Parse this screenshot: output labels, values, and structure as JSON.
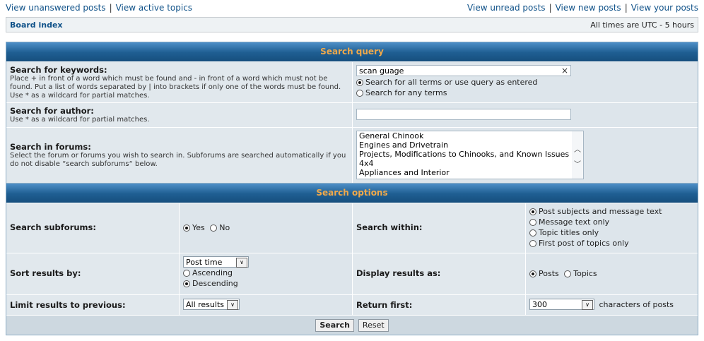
{
  "toplinks": {
    "unanswered": "View unanswered posts",
    "active": "View active topics",
    "unread": "View unread posts",
    "new": "View new posts",
    "yours": "View your posts",
    "separator": "|"
  },
  "navbar": {
    "board_index": "Board index",
    "timezone": "All times are UTC - 5 hours"
  },
  "search_query": {
    "heading": "Search query",
    "keywords_label": "Search for keywords:",
    "keywords_explain": "Place + in front of a word which must be found and - in front of a word which must not be found. Put a list of words separated by | into brackets if only one of the words must be found. Use * as a wildcard for partial matches.",
    "keywords_value": "scan guage",
    "terms_all": "Search for all terms or use query as entered",
    "terms_any": "Search for any terms",
    "author_label": "Search for author:",
    "author_explain": "Use * as a wildcard for partial matches.",
    "author_value": "",
    "forums_label": "Search in forums:",
    "forums_explain": "Select the forum or forums you wish to search in. Subforums are searched automatically if you do not disable “search subforums“ below.",
    "forums": [
      "General Chinook",
      "Engines and Drivetrain",
      "Projects, Modifications to Chinooks, and Known Issues",
      "4x4",
      "Appliances and Interior"
    ]
  },
  "search_options": {
    "heading": "Search options",
    "subforums_label": "Search subforums:",
    "yes": "Yes",
    "no": "No",
    "within_label": "Search within:",
    "within_opts": [
      "Post subjects and message text",
      "Message text only",
      "Topic titles only",
      "First post of topics only"
    ],
    "sort_label": "Sort results by:",
    "sort_value": "Post time",
    "ascending": "Ascending",
    "descending": "Descending",
    "display_label": "Display results as:",
    "posts": "Posts",
    "topics": "Topics",
    "limit_label": "Limit results to previous:",
    "limit_value": "All results",
    "return_label": "Return first:",
    "return_value": "300",
    "return_suffix": "characters of posts",
    "search_btn": "Search",
    "reset_btn": "Reset"
  },
  "colors": {
    "link": "#105289",
    "heading_text": "#f0a94a",
    "heading_bg": "#1f5f93"
  }
}
